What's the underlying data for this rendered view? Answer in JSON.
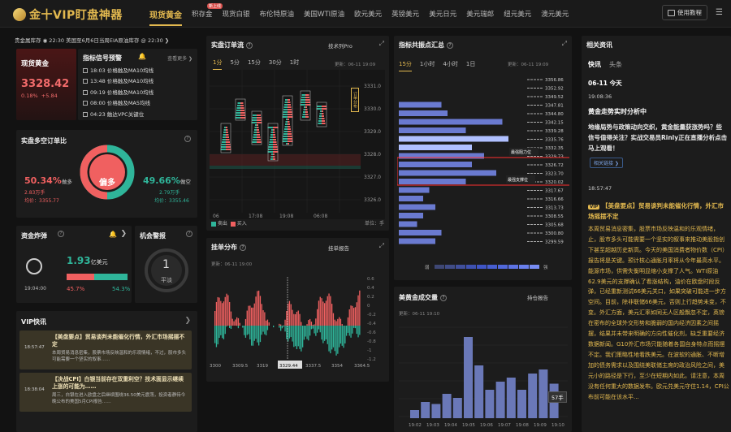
{
  "app": {
    "logo": "金十VIP盯盘神器"
  },
  "nav": [
    {
      "label": "现货黄金",
      "active": true
    },
    {
      "label": "积存金",
      "badge": "新上线"
    },
    {
      "label": "现货白银"
    },
    {
      "label": "布伦特原油"
    },
    {
      "label": "美国WTI原油"
    },
    {
      "label": "欧元美元"
    },
    {
      "label": "英镑美元"
    },
    {
      "label": "美元日元"
    },
    {
      "label": "美元瑞郎"
    },
    {
      "label": "纽元美元"
    },
    {
      "label": "澳元美元"
    }
  ],
  "nav_badge": "新上线",
  "top_buttons": {
    "tutorial": "使用教程"
  },
  "ticker": "贵金属库存 ◉ 22:30 美国至6月6日当周EIA原油库存 @ 22:30 ❯",
  "price": {
    "title": "现货黄金",
    "value": "3328.42",
    "pct": "0.18%",
    "chg": "+5.84"
  },
  "signals": {
    "title": "指标信号预警",
    "more": "查看更多 ❯",
    "items": [
      {
        "time": "18:03",
        "text": "价格触及MA10均线"
      },
      {
        "time": "13:48",
        "text": "价格触及MA10均线"
      },
      {
        "time": "09:19",
        "text": "价格触及MA10均线"
      },
      {
        "time": "08:00",
        "text": "价格触及MA5均线"
      },
      {
        "time": "04:23",
        "text": "触达VPC关键位"
      }
    ]
  },
  "longshort": {
    "title": "实盘多空订单比",
    "center": "偏多",
    "long_pct": "50.34%",
    "long_label": "做多",
    "long_amt": "2.83万手",
    "long_avg": "均价：3355.77",
    "short_pct": "49.66%",
    "short_label": "做空",
    "short_amt": "2.79万手",
    "short_avg": "均价：3355.46"
  },
  "bomb": {
    "title": "资金炸弹",
    "time": "19:04:00",
    "amount": "1.93",
    "unit": "亿美元",
    "red_pct": "45.7%",
    "green_pct": "54.3%",
    "red_ratio": 0.457
  },
  "opp": {
    "title": "机会警报",
    "value": "1",
    "label": "平淡"
  },
  "vip": {
    "title": "VIP快讯",
    "items": [
      {
        "time": "18:57:47",
        "title": "【美盘要点】贸易谈判未能催化行情，外汇市场摇摆不定",
        "body": "本周贸易消息密集，股票市场反映温和的乐观情绪，不过，股市多头可能需要一个坚实的叙事……"
      },
      {
        "time": "18:38:04",
        "title": "【决战CPI】白银当前存在双重利空？技术面显示继续上涨的可能为……",
        "body": "周三，白银在进入欧盘之后继续围绕36.50美元震荡，投资者静待今晚公布的美国5月CPI报告……"
      }
    ]
  },
  "orderflow": {
    "title": "实盘订单流",
    "link": "技术列Pro",
    "tabs": [
      "1分",
      "5分",
      "15分",
      "30分",
      "1时"
    ],
    "updated": "更新：06-11 19:09",
    "yticks": [
      "3331.0",
      "3330.0",
      "3329.0",
      "3328.0",
      "3327.0",
      "3326.0",
      "3325.0"
    ],
    "xticks": [
      "06",
      "17:08",
      "19:08",
      "06:08"
    ],
    "legend_sell": "卖出",
    "legend_buy": "买入",
    "unit": "单位：手",
    "side_tag": "订单分布"
  },
  "pending": {
    "title": "挂单分布",
    "link": "挂单报告",
    "updated": "更新：06-11 19:00",
    "xticks": [
      "3300",
      "3309.5",
      "3319",
      "3329.44",
      "3337.5",
      "3354",
      "3364.5"
    ],
    "yticks": [
      "0.6",
      "0.4",
      "0.2",
      "0",
      "-0.2",
      "-0.4",
      "-0.6",
      "-0.8",
      "-1",
      "-1.2"
    ]
  },
  "indicators": {
    "title": "指标共振点汇总",
    "tabs": [
      "15分",
      "1小时",
      "4小时",
      "1日"
    ],
    "updated": "更新：06-11 19:09",
    "levels": [
      "3356.86",
      "3352.92",
      "3349.52",
      "3347.81",
      "3344.80",
      "3342.15",
      "3339.28",
      "3335.76",
      "3332.35",
      "3329.73",
      "3326.72",
      "3323.70",
      "3320.02",
      "3317.67",
      "3316.66",
      "3313.73",
      "3308.55",
      "3305.68",
      "3300.80",
      "3299.59"
    ],
    "bars": [
      0,
      0,
      0,
      0.35,
      0.4,
      0.85,
      0.55,
      0.9,
      0.6,
      0.7,
      0.6,
      0.8,
      0.55,
      0.25,
      0.2,
      0.3,
      0.2,
      0.15,
      0.35,
      0.3
    ],
    "tip1": "最强阻力位",
    "tip2": "最强支撑位",
    "weak": "弱",
    "strong": "强"
  },
  "volume": {
    "title": "美黄金成交量",
    "link": "持仓报告",
    "updated": "更新：06-11 19:10",
    "bars": [
      20,
      40,
      35,
      60,
      50,
      200,
      130,
      70,
      90,
      100,
      70,
      110,
      120,
      85
    ],
    "xticks": [
      "19:02",
      "19:03",
      "19:04",
      "19:05",
      "19:06",
      "19:07",
      "19:08",
      "19:09",
      "19:10"
    ],
    "badge": "57手"
  },
  "news": {
    "title": "相关资讯",
    "tabs": [
      "快讯",
      "头条"
    ],
    "date": "06-11 今天",
    "first_time": "19:08:36",
    "first_title": "黄金走势实时分析中",
    "first_body": "地缘局势与政策动向交织，黄金能量获涨势吗？些信号值得关注？实战交易员Rinly正在直播分析点击马上观看！",
    "first_link": "相关链接 ❯",
    "second_time": "18:57:47",
    "vip_tag": "VIP",
    "second_title": "【美盘要点】贸易谈判未能催化行情，外汇市场摇摆不定",
    "second_body": "本周贸易消息密集，股票市场反映温和的乐观情绪，止，股市多头可能需要一个坚实的叙事来推动美股指创下甚至超越历史新高。今天的美国消费者物价数（CPI）报告将是关键。预计核心通胀月率将从今年最高水平。能源市场，供需失衡明显缩小支撑了人气。WTI原油62.9美元的支撑确认了看涨结构，油价在欧盘时段反弹，已经重新测试66美元关口，如果突破可能进一步方空间。目前，除非联储66美元，否则上行趋势未变，不变。外汇方面，美元汇率如同无人区般飘忽不定，英镑在密布的全球外交形势和脆弱的国内经济因素之间摇摆，结果并未带来明确的方向性催化剂，缺乏重要经济数据新闻。G10外汇市场只能随着各国自身特点而摇摆不定。我们策略性地看跌美元。在波软的通胀、不断增加的债务需求以及围绕美联储主席的政治风险之间，美元小的路径是下行，至少在短期内如此。请注意，本周没有任何重大的数据发布。欧元兑美元守住1.14，CPI公布前可能在该水平..."
  }
}
